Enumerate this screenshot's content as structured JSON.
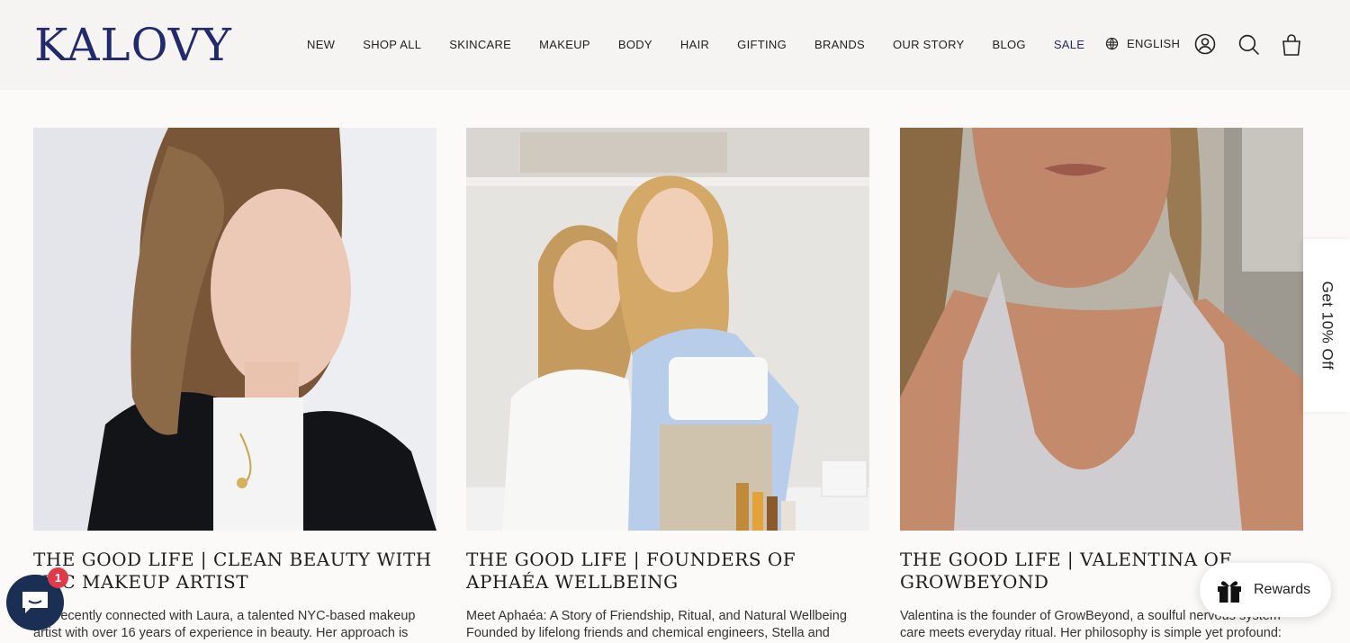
{
  "brand": {
    "logo": "KALOVY",
    "color": "#232a6b"
  },
  "nav": {
    "items": [
      "NEW",
      "SHOP ALL",
      "SKINCARE",
      "MAKEUP",
      "BODY",
      "HAIR",
      "GIFTING",
      "BRANDS",
      "OUR STORY",
      "BLOG",
      "SALE"
    ],
    "sale_color": "#232a6b"
  },
  "header": {
    "language": "ENGLISH",
    "icons": [
      "globe-icon",
      "account-icon",
      "search-icon",
      "cart-icon"
    ]
  },
  "posts": [
    {
      "title": "THE GOOD LIFE | CLEAN BEAUTY WITH NYC MAKEUP ARTIST",
      "excerpt": "We recently connected with Laura, a talented NYC-based makeup artist with over 16 years of experience in beauty. Her approach is"
    },
    {
      "title": "THE GOOD LIFE | FOUNDERS OF APHAÉA WELLBEING",
      "excerpt": "Meet Aphaéa: A Story of Friendship, Ritual, and Natural Wellbeing Founded by lifelong friends and chemical engineers, Stella and"
    },
    {
      "title": "THE GOOD LIFE | VALENTINA OF GROWBEYOND",
      "excerpt": "Valentina is the founder of GrowBeyond, a soulful nervous system care meets everyday ritual. Her philosophy is simple yet profound: true well-being begins when we slow down..."
    }
  ],
  "side_tab": {
    "label": "Get 10% Off"
  },
  "rewards": {
    "label": "Rewards"
  },
  "chat": {
    "badge": "1",
    "color": "#1b2f55"
  }
}
